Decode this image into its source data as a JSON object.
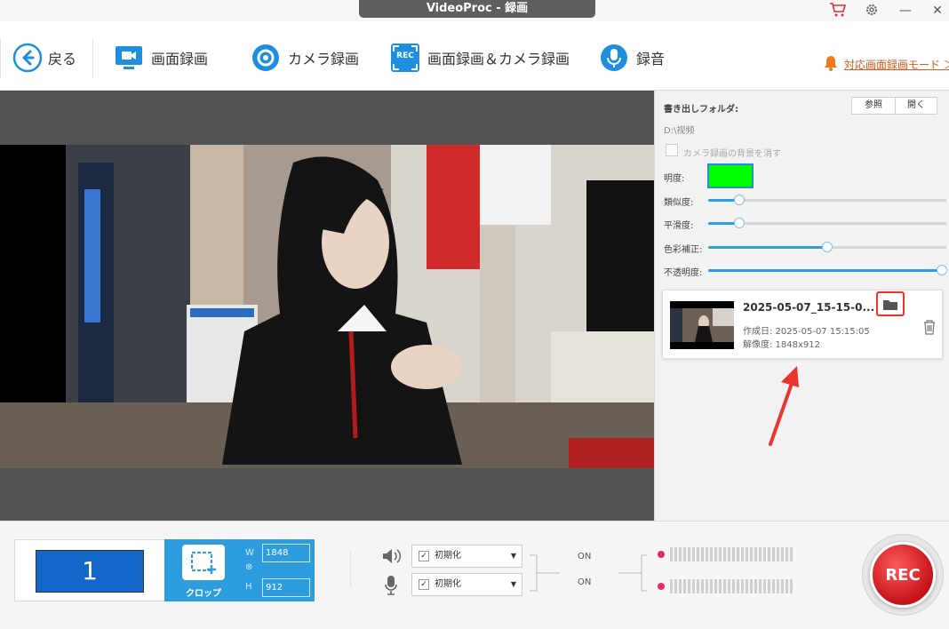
{
  "window": {
    "title": "VideoProc - 録画"
  },
  "toolbar": {
    "back_label": "戻る",
    "screen_rec_label": "画面録画",
    "camera_rec_label": "カメラ録画",
    "both_rec_label": "画面録画＆カメラ録画",
    "rec_badge": "REC",
    "audio_label": "録音",
    "mode_link": "対応画面録画モード ＞"
  },
  "panel": {
    "folder_label": "書き出しフォルダ:",
    "browse_label": "参照",
    "open_label": "開く",
    "folder_path": "D:\\视频",
    "remove_bg_label": "カメラ録画の背景を消す",
    "brightness_label": "明度:",
    "key_color": "#00ff00",
    "similarity_label": "類似度:",
    "similarity_value": 0.13,
    "smoothness_label": "平滑度:",
    "smoothness_value": 0.13,
    "color_correction_label": "色彩補正:",
    "color_correction_value": 0.5,
    "opacity_label": "不透明度:",
    "opacity_value": 1.0
  },
  "recording": {
    "filename": "2025-05-07_15-15-0...",
    "created_label": "作成日: 2025-05-07 15:15:05",
    "resolution_label": "解像度: 1848x912"
  },
  "bottom": {
    "screen_number": "1",
    "crop_label": "クロップ",
    "width_label": "W",
    "height_label": "H",
    "width_value": "1848",
    "height_value": "912",
    "speaker_dropdown": "初期化",
    "mic_dropdown": "初期化",
    "speaker_state": "ON",
    "mic_state": "ON",
    "rec_button": "REC"
  },
  "colors": {
    "accent": "#2d9de0",
    "rec_red": "#d9161d",
    "highlight": "#e8362f",
    "link": "#d35a1a"
  }
}
